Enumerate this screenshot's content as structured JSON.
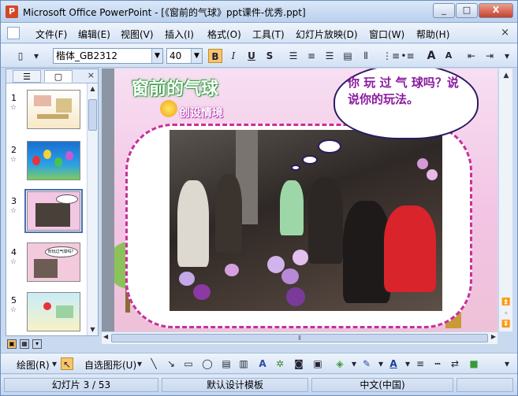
{
  "window": {
    "title": "Microsoft Office PowerPoint - [《窗前的气球》ppt课件-优秀.ppt]",
    "app_icon_glyph": "P",
    "controls": {
      "minimize": "_",
      "maximize": "□",
      "close": "X"
    }
  },
  "menubar": {
    "items": [
      "文件(F)",
      "编辑(E)",
      "视图(V)",
      "插入(I)",
      "格式(O)",
      "工具(T)",
      "幻灯片放映(D)",
      "窗口(W)",
      "帮助(H)"
    ],
    "close_glyph": "×"
  },
  "toolbar": {
    "font_name": "楷体_GB2312",
    "font_size": "40",
    "bold": "B",
    "italic": "I",
    "underline": "U",
    "shadow": "S",
    "grow_font": "A",
    "shrink_font": "A"
  },
  "outline_pane": {
    "tabs": [
      "☰",
      "▢"
    ],
    "close_glyph": "×",
    "slides": [
      {
        "number": "1",
        "star": "☆"
      },
      {
        "number": "2",
        "star": "☆"
      },
      {
        "number": "3",
        "star": "☆"
      },
      {
        "number": "4",
        "star": "☆"
      },
      {
        "number": "5",
        "star": "☆"
      }
    ],
    "selected_slide": "3"
  },
  "slide": {
    "title": "窗前的气球",
    "subtitle": "创设情境",
    "speech_bubble": "你 玩 过 气 球吗？说说你的玩法。",
    "thumb_bubble": "你玩过气球吗？"
  },
  "drawing_toolbar": {
    "draw_menu": "绘图(R)",
    "autoshapes_menu": "自选图形(U)"
  },
  "statusbar": {
    "slide_info": "幻灯片 3 / 53",
    "template": "默认设计模板",
    "language": "中文(中国)"
  },
  "colors": {
    "title_green": "#3aa14a",
    "subtitle_purple": "#b53ab0",
    "bubble_text": "#8a1aa0",
    "frame_dash": "#c8309a"
  }
}
